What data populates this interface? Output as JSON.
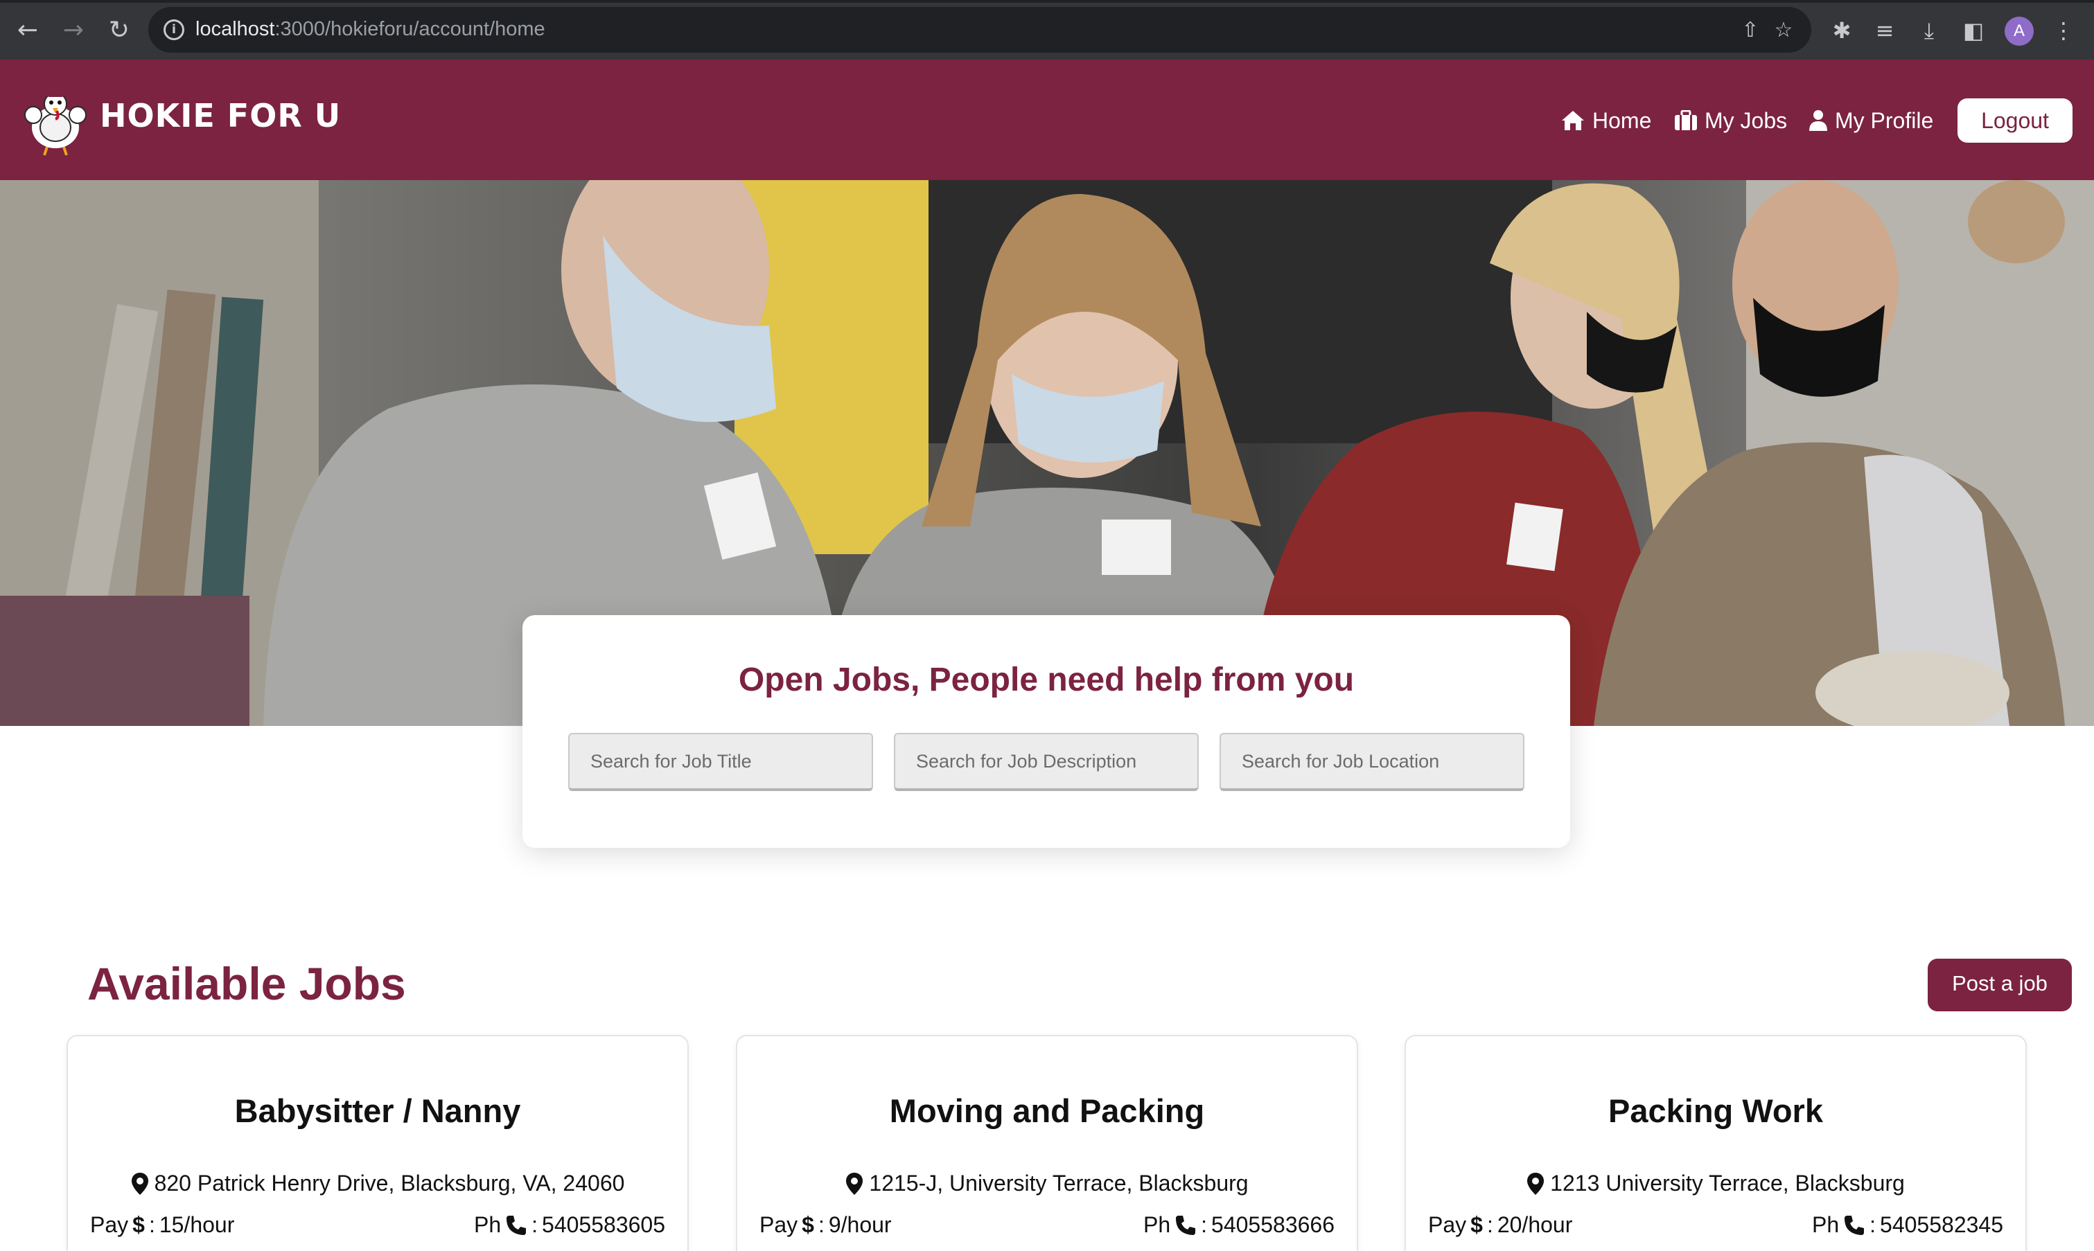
{
  "browser": {
    "url_host": "localhost",
    "url_path": ":3000/hokieforu/account/home",
    "profile_initial": "A"
  },
  "nav": {
    "brand": "HOKIE FOR U",
    "home": "Home",
    "my_jobs": "My Jobs",
    "my_profile": "My Profile",
    "logout": "Logout"
  },
  "search": {
    "title": "Open Jobs, People need help from you",
    "title_placeholder": "Search for Job Title",
    "description_placeholder": "Search for Job Description",
    "location_placeholder": "Search for Job Location"
  },
  "jobs": {
    "heading": "Available Jobs",
    "post_button": "Post a job",
    "pay_label": "Pay",
    "ph_label": "Ph",
    "items": [
      {
        "title": "Babysitter / Nanny",
        "address": "820 Patrick Henry Drive, Blacksburg, VA, 24060",
        "pay": "15/hour",
        "phone": "5405583605"
      },
      {
        "title": "Moving and Packing",
        "address": "1215-J, University Terrace, Blacksburg",
        "pay": "9/hour",
        "phone": "5405583666"
      },
      {
        "title": "Packing Work",
        "address": "1213 University Terrace, Blacksburg",
        "pay": "20/hour",
        "phone": "5405582345"
      }
    ]
  },
  "colors": {
    "brand_maroon": "#7b2340",
    "chrome_dark": "#35363a"
  }
}
